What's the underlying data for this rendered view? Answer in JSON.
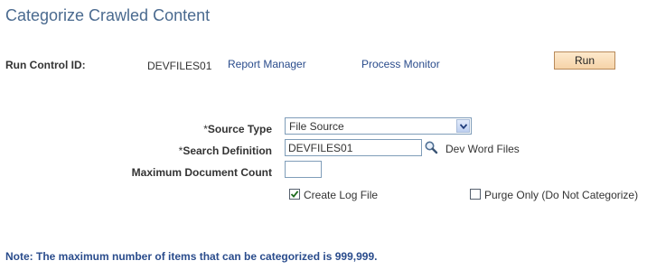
{
  "page": {
    "title": "Categorize Crawled Content"
  },
  "run_control": {
    "label": "Run Control ID:",
    "value": "DEVFILES01",
    "report_manager_link": "Report Manager",
    "process_monitor_link": "Process Monitor",
    "run_button": "Run"
  },
  "form": {
    "source_type": {
      "required_marker": "*",
      "label": "Source Type",
      "selected": "File Source"
    },
    "search_definition": {
      "required_marker": "*",
      "label": "Search Definition",
      "value": "DEVFILES01",
      "description": "Dev Word Files"
    },
    "max_document_count": {
      "label": "Maximum Document Count",
      "value": ""
    },
    "create_log_file": {
      "label": "Create Log File",
      "checked": true
    },
    "purge_only": {
      "label": "Purge Only (Do Not Categorize)",
      "checked": false
    }
  },
  "note": "Note: The maximum number of items that can be categorized is 999,999.",
  "colors": {
    "title": "#4a6a8f",
    "link": "#2a4c8c",
    "button_border": "#b88a5a",
    "input_border": "#7f9db9"
  },
  "icons": {
    "lookup": "magnifier-icon",
    "dropdown": "chevron-down-icon",
    "check": "checkmark-icon"
  }
}
